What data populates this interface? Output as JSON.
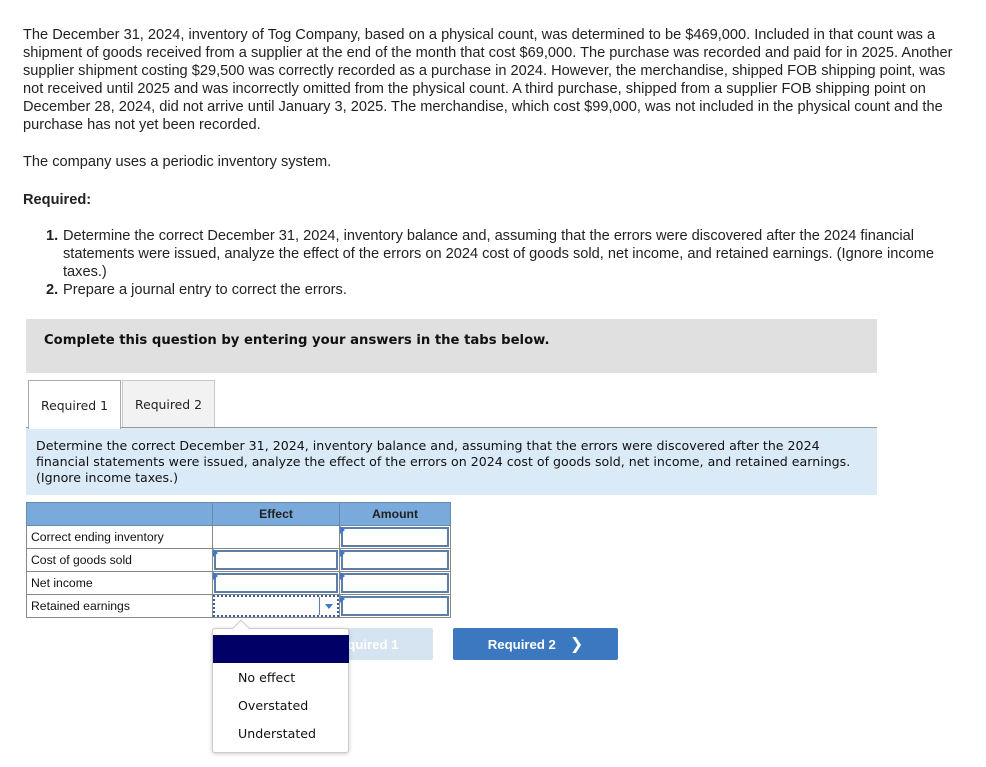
{
  "problem": {
    "paragraph": "The December 31, 2024, inventory of Tog Company, based on a physical count, was determined to be $469,000. Included in that count was a shipment of goods received from a supplier at the end of the month that cost $69,000. The purchase was recorded and paid for in 2025. Another supplier shipment costing $29,500 was correctly recorded as a purchase in 2024. However, the merchandise, shipped FOB shipping point, was not received until 2025 and was incorrectly omitted from the physical count. A third purchase, shipped from a supplier FOB shipping point on December 28, 2024, did not arrive until January 3, 2025. The merchandise, which cost $99,000, was not included in the physical count and the purchase has not yet been recorded.",
    "system_note": "The company uses a periodic inventory system.",
    "required_heading": "Required:",
    "requirements": [
      {
        "num": "1.",
        "text": "Determine the correct December 31, 2024, inventory balance and, assuming that the errors were discovered after the 2024 financial statements were issued, analyze the effect of the errors on 2024 cost of goods sold, net income, and retained earnings. (Ignore income taxes.)"
      },
      {
        "num": "2.",
        "text": "Prepare a journal entry to correct the errors."
      }
    ]
  },
  "banner": "Complete this question by entering your answers in the tabs below.",
  "tabs": [
    {
      "label": "Required 1",
      "active": true
    },
    {
      "label": "Required 2",
      "active": false
    }
  ],
  "instructions": "Determine the correct December 31, 2024, inventory balance and, assuming that the errors were discovered after the 2024 financial statements were issued, analyze the effect of the errors on 2024 cost of goods sold, net income, and retained earnings. (Ignore income taxes.)",
  "table": {
    "headers": [
      "",
      "Effect",
      "Amount"
    ],
    "rows": [
      {
        "label": "Correct ending inventory",
        "effect": "",
        "amount": ""
      },
      {
        "label": "Cost of goods sold",
        "effect": "",
        "amount": ""
      },
      {
        "label": "Net income",
        "effect": "",
        "amount": ""
      },
      {
        "label": "Retained earnings",
        "effect": "",
        "amount": ""
      }
    ]
  },
  "dropdown": {
    "selected": "",
    "options": [
      "No effect",
      "Overstated",
      "Understated"
    ]
  },
  "nav": {
    "prev_label": "Required 1",
    "next_label": "Required 2",
    "next_icon": "chevron-right-icon"
  },
  "colors": {
    "header_blue": "#7aa9dc",
    "instruction_bg": "#dbeaf7",
    "banner_gray": "#e0e0e0",
    "next_button": "#3b78bf",
    "prev_button_disabled": "#d6e3f1",
    "dropdown_highlight": "#000066"
  }
}
